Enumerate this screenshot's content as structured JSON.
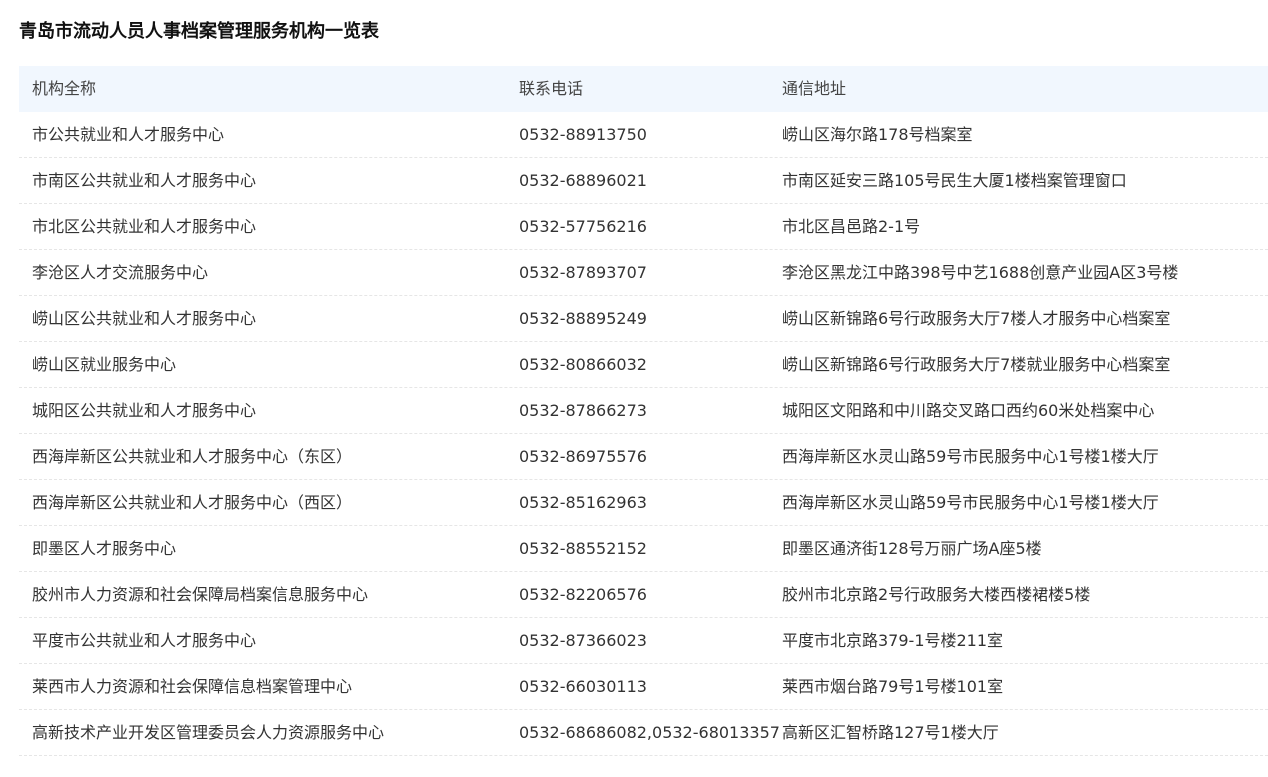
{
  "page": {
    "title": "青岛市流动人员人事档案管理服务机构一览表"
  },
  "table": {
    "columns": [
      "机构全称",
      "联系电话",
      "通信地址"
    ],
    "rows": [
      {
        "name": "市公共就业和人才服务中心",
        "phone": "0532-88913750",
        "address": "崂山区海尔路178号档案室"
      },
      {
        "name": "市南区公共就业和人才服务中心",
        "phone": "0532-68896021",
        "address": "市南区延安三路105号民生大厦1楼档案管理窗口"
      },
      {
        "name": "市北区公共就业和人才服务中心",
        "phone": "0532-57756216",
        "address": "市北区昌邑路2-1号"
      },
      {
        "name": "李沧区人才交流服务中心",
        "phone": "0532-87893707",
        "address": "李沧区黑龙江中路398号中艺1688创意产业园A区3号楼"
      },
      {
        "name": "崂山区公共就业和人才服务中心",
        "phone": "0532-88895249",
        "address": "崂山区新锦路6号行政服务大厅7楼人才服务中心档案室"
      },
      {
        "name": "崂山区就业服务中心",
        "phone": "0532-80866032",
        "address": "崂山区新锦路6号行政服务大厅7楼就业服务中心档案室"
      },
      {
        "name": "城阳区公共就业和人才服务中心",
        "phone": "0532-87866273",
        "address": "城阳区文阳路和中川路交叉路口西约60米处档案中心"
      },
      {
        "name": "西海岸新区公共就业和人才服务中心（东区）",
        "phone": "0532-86975576",
        "address": "西海岸新区水灵山路59号市民服务中心1号楼1楼大厅"
      },
      {
        "name": "西海岸新区公共就业和人才服务中心（西区）",
        "phone": "0532-85162963",
        "address": "西海岸新区水灵山路59号市民服务中心1号楼1楼大厅"
      },
      {
        "name": "即墨区人才服务中心",
        "phone": "0532-88552152",
        "address": "即墨区通济街128号万丽广场A座5楼"
      },
      {
        "name": "胶州市人力资源和社会保障局档案信息服务中心",
        "phone": "0532-82206576",
        "address": "胶州市北京路2号行政服务大楼西楼裙楼5楼"
      },
      {
        "name": "平度市公共就业和人才服务中心",
        "phone": "0532-87366023",
        "address": "平度市北京路379-1号楼211室"
      },
      {
        "name": "莱西市人力资源和社会保障信息档案管理中心",
        "phone": "0532-66030113",
        "address": "莱西市烟台路79号1号楼101室"
      },
      {
        "name": "高新技术产业开发区管理委员会人力资源服务中心",
        "phone": "0532-68686082,0532-68013357",
        "address": "高新区汇智桥路127号1楼大厅"
      }
    ]
  },
  "colors": {
    "header_bg": "#f1f7fe",
    "row_divider": "#e6e6e6",
    "text": "#333333",
    "title": "#111111"
  }
}
